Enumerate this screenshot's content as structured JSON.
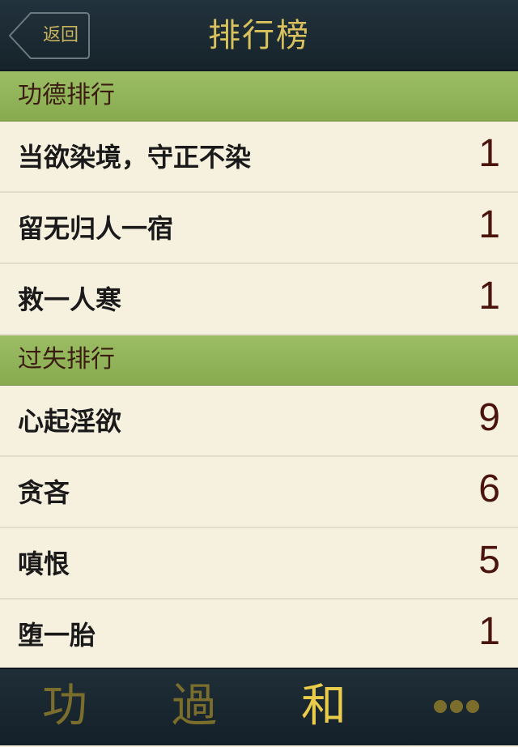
{
  "navbar": {
    "back_label": "返回",
    "title": "排行榜"
  },
  "sections": [
    {
      "header": "功德排行",
      "rows": [
        {
          "label": "当欲染境，守正不染",
          "count": "1"
        },
        {
          "label": "留无归人一宿",
          "count": "1"
        },
        {
          "label": "救一人寒",
          "count": "1"
        }
      ]
    },
    {
      "header": "过失排行",
      "rows": [
        {
          "label": "心起淫欲",
          "count": "9"
        },
        {
          "label": "贪吝",
          "count": "6"
        },
        {
          "label": "嗔恨",
          "count": "5"
        },
        {
          "label": "堕一胎",
          "count": "1"
        }
      ]
    }
  ],
  "tabbar": {
    "tabs": [
      {
        "label": "功",
        "icon": "merit-glyph-icon",
        "active": false
      },
      {
        "label": "過",
        "icon": "fault-glyph-icon",
        "active": false
      },
      {
        "label": "和",
        "icon": "harmony-glyph-icon",
        "active": true
      },
      {
        "label": "",
        "icon": "more-icon",
        "active": false
      }
    ]
  },
  "colors": {
    "navbar_bg": "#1c2b34",
    "accent_gold": "#d9c25e",
    "section_header_bg": "#94b65a",
    "row_bg": "#f6f0df",
    "count_color": "#4a130c"
  }
}
